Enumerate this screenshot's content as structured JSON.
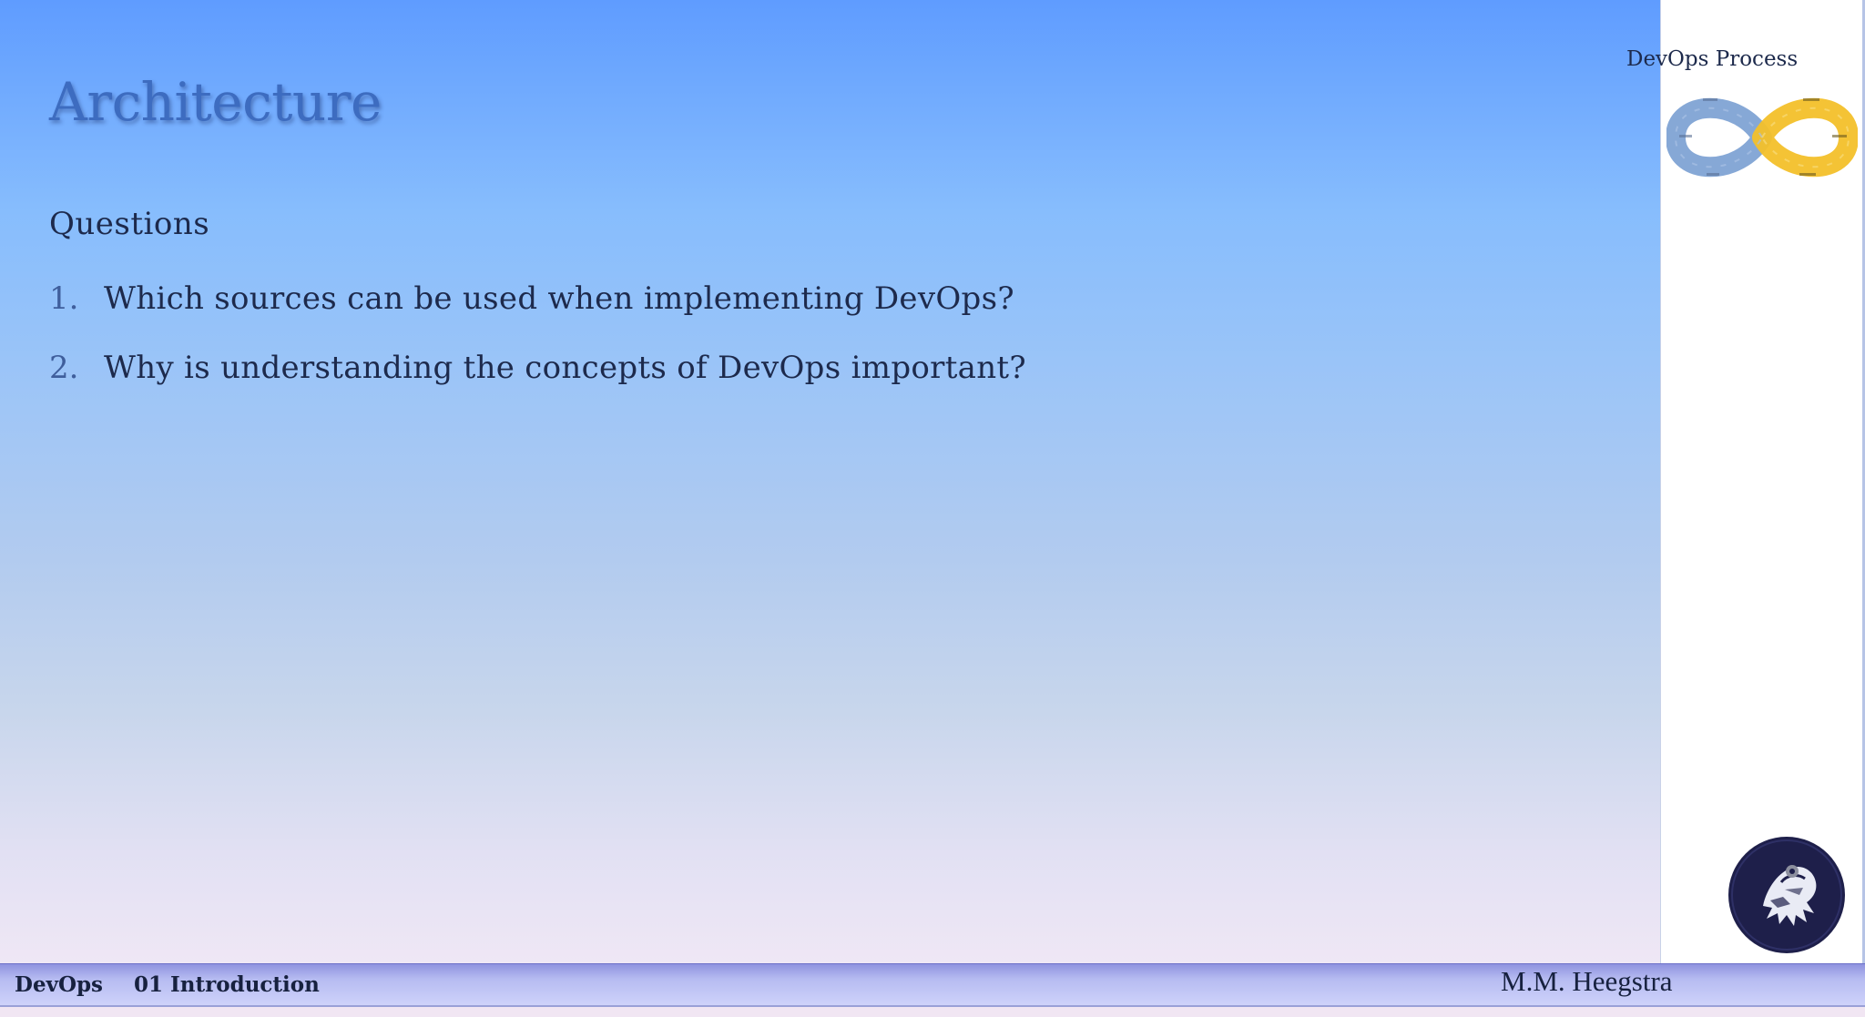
{
  "slide": {
    "title": "Architecture",
    "subheading": "Questions",
    "questions": [
      {
        "number": "1.",
        "text": "Which sources can be used when implementing DevOps?"
      },
      {
        "number": "2.",
        "text": "Why is understanding the concepts of DevOps important?"
      }
    ]
  },
  "side_panel": {
    "caption": "DevOps Process",
    "logo_icon": "devops-infinity-loop-icon",
    "emblem_icon": "hawk-emblem-icon"
  },
  "footer": {
    "course": "DevOps",
    "chapter": "01 Introduction",
    "author": "M.M. Heegstra"
  },
  "colors": {
    "title": "#3d6cc0",
    "body_text": "#1d2a4c",
    "loop_left": "#7fa3d4",
    "loop_right": "#f3c02a",
    "emblem_bg": "#1e1f4a"
  }
}
